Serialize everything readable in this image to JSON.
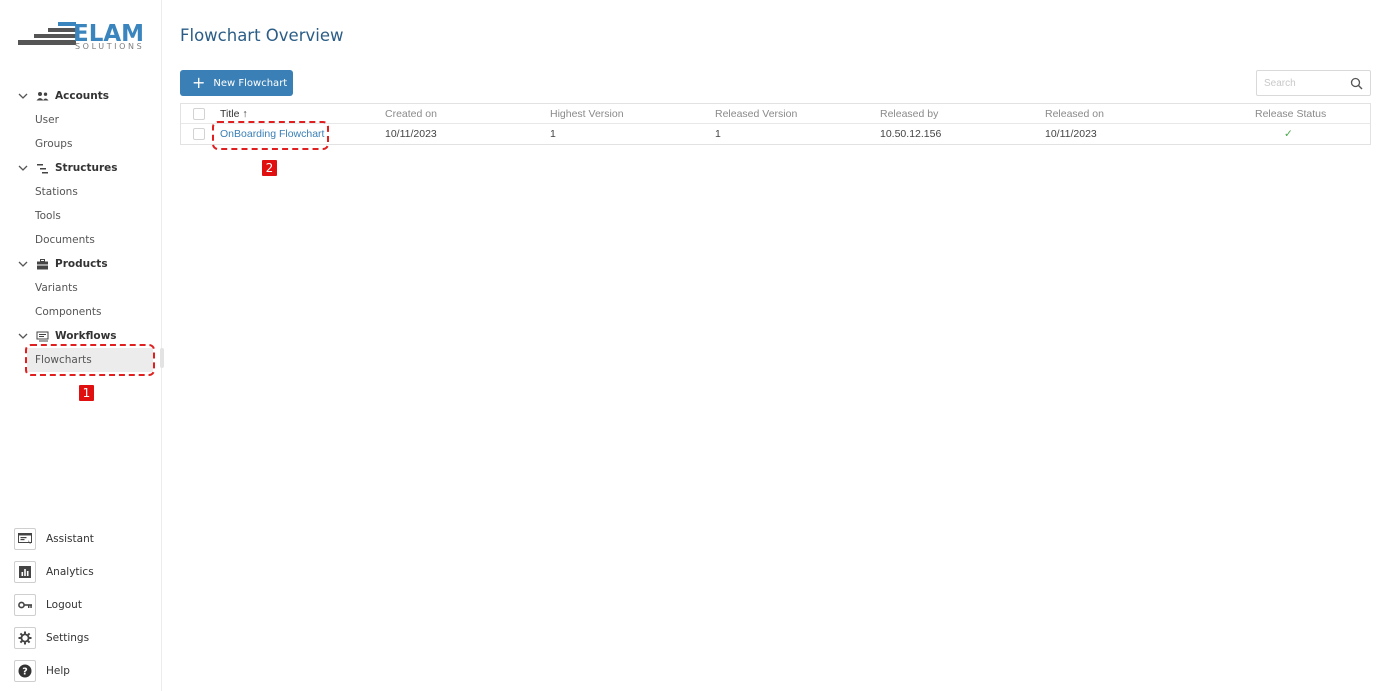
{
  "logo": {
    "word": "ELAM",
    "sub": "SOLUTIONS"
  },
  "sidebar": {
    "sections": [
      {
        "label": "Accounts",
        "icon": "users-icon",
        "items": [
          "User",
          "Groups"
        ]
      },
      {
        "label": "Structures",
        "icon": "structure-icon",
        "items": [
          "Stations",
          "Tools",
          "Documents"
        ]
      },
      {
        "label": "Products",
        "icon": "briefcase-icon",
        "items": [
          "Variants",
          "Components"
        ]
      },
      {
        "label": "Workflows",
        "icon": "workflow-icon",
        "items": [
          "Flowcharts"
        ]
      }
    ],
    "active_item": "Flowcharts",
    "bottom": [
      {
        "label": "Assistant",
        "icon": "assistant-icon"
      },
      {
        "label": "Analytics",
        "icon": "analytics-icon"
      },
      {
        "label": "Logout",
        "icon": "key-icon"
      },
      {
        "label": "Settings",
        "icon": "gear-icon"
      },
      {
        "label": "Help",
        "icon": "help-icon"
      }
    ]
  },
  "main": {
    "title": "Flowchart Overview",
    "new_button": "New Flowchart",
    "search_placeholder": "Search",
    "columns": [
      "Title",
      "Created on",
      "Highest Version",
      "Released Version",
      "Released by",
      "Released on",
      "Release Status"
    ],
    "sort_indicator": "↑",
    "rows": [
      {
        "title": "OnBoarding Flowchart",
        "created_on": "10/11/2023",
        "highest_version": "1",
        "released_version": "1",
        "released_by": "10.50.12.156",
        "released_on": "10/11/2023",
        "status": "✓"
      }
    ]
  },
  "annotations": [
    "1",
    "2"
  ],
  "colors": {
    "accent": "#3a7fb5",
    "title": "#2b5d86",
    "annotation": "#e02020",
    "check": "#49a84a"
  }
}
